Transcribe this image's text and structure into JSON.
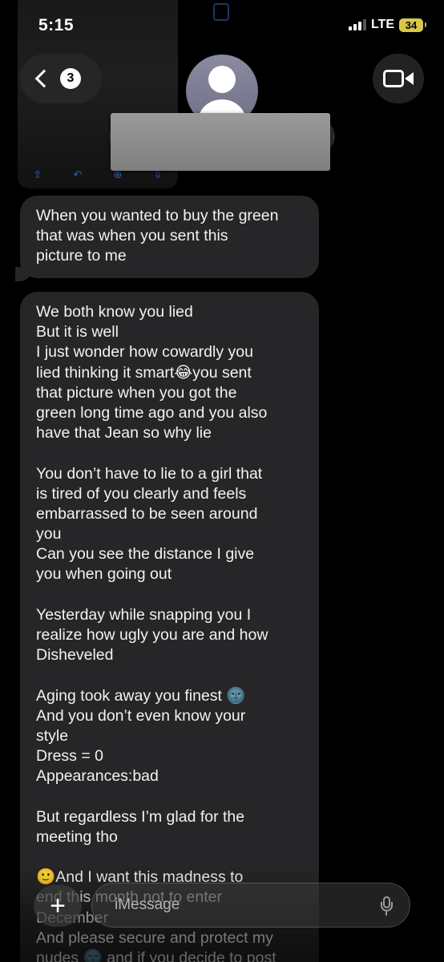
{
  "status_bar": {
    "time": "5:15",
    "network": "LTE",
    "battery": "34"
  },
  "header": {
    "unread_count": "3",
    "contact_name": ""
  },
  "photo_toolbar": [
    "share",
    "reply",
    "zoom",
    "save"
  ],
  "messages": [
    {
      "direction": "incoming",
      "lines": [
        "When you wanted to buy the green",
        "that was when you sent this",
        "picture to me"
      ]
    },
    {
      "direction": "incoming",
      "lines": [
        "We both know you lied",
        "But it is well",
        "I just wonder how cowardly you",
        "lied thinking it smart😂you sent",
        "that picture when you got the",
        "green long time ago and you also",
        "have that Jean so why lie",
        "",
        "You don’t have to lie to a girl that",
        "is tired of you clearly and feels",
        "embarrassed to be seen around",
        "you",
        "Can you see the distance I give",
        "you when going out",
        "",
        "Yesterday while snapping you I",
        "realize how ugly you are and how",
        "Disheveled",
        "",
        "Aging took away you finest 🌚",
        "And you don’t even know your",
        "style",
        "Dress = 0",
        "Appearances:bad",
        "",
        "But regardless I’m glad for the",
        "meeting tho",
        "",
        "🙂And I want this madness to",
        "end this month not to enter",
        "December",
        "And please secure and protect my",
        "nudes 🌚 and if you decide to post"
      ]
    }
  ],
  "composer": {
    "placeholder": "iMessage"
  },
  "colors": {
    "background": "#000000",
    "bubble_incoming": "#262628",
    "battery": "#d8c84a"
  }
}
